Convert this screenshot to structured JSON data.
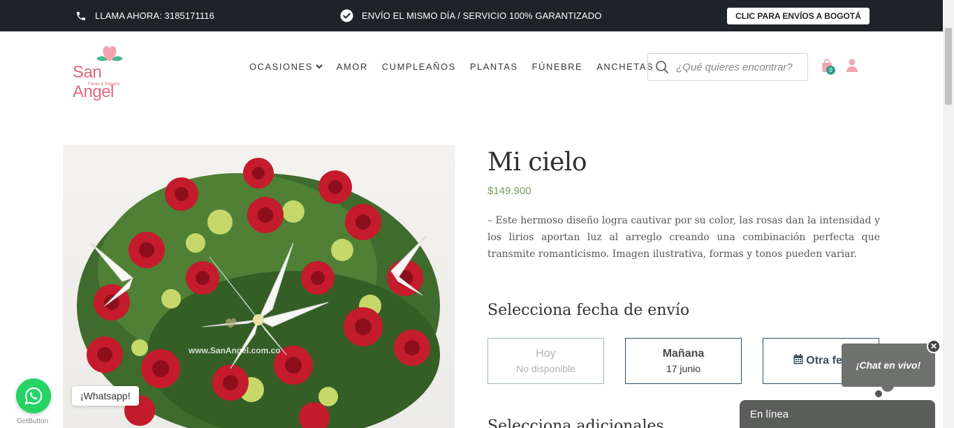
{
  "topbar": {
    "call_text": "LLAMA AHORA: 3185171116",
    "ship_text": "ENVÍO EL MISMO DÍA / SERVICIO 100% GARANTIZADO",
    "bogota_button": "CLIC PARA ENVÍOS A BOGOTÁ",
    "background": "#1f2327"
  },
  "logo": {
    "brand": "San Angel",
    "tagline": "Flores & Regalos"
  },
  "nav": {
    "items": [
      {
        "label": "OCASIONES",
        "has_dropdown": true
      },
      {
        "label": "AMOR"
      },
      {
        "label": "CUMPLEAÑOS"
      },
      {
        "label": "PLANTAS"
      },
      {
        "label": "FÚNEBRE"
      },
      {
        "label": "ANCHETAS"
      }
    ]
  },
  "search": {
    "placeholder": "¿Qué quieres encontrar?",
    "icon": "search-icon"
  },
  "cart": {
    "count": "0",
    "icon": "shopping-bag-icon"
  },
  "user": {
    "icon": "user-icon"
  },
  "product": {
    "title": "Mi cielo",
    "price": "$149.900",
    "description": "– Este hermoso diseño logra cautivar por su color, las rosas dan la intensidad y los lirios aportan luz al arreglo creando una combinación perfecta que transmite romanticismo. Imagen ilustrativa, formas y tonos pueden variar.",
    "image_watermark": "www.SanAngel.com.co"
  },
  "delivery": {
    "heading": "Selecciona fecha de envío",
    "options": [
      {
        "label": "Hoy",
        "sub": "No disponible"
      },
      {
        "label": "Mañana",
        "sub": "17 junio"
      },
      {
        "label": "Otra fec",
        "icon": "calendar-icon"
      }
    ],
    "next_heading": "Selecciona adicionales"
  },
  "chat": {
    "bubble": "¡Chat en vivo!",
    "status_bar": "En línea"
  },
  "whatsapp": {
    "label": "¡Whatsapp!",
    "credit": "GetButton",
    "color": "#25d366"
  },
  "colors": {
    "accent": "#e06a7d",
    "price": "#7a9a5e",
    "teal": "#2e9e8a"
  }
}
